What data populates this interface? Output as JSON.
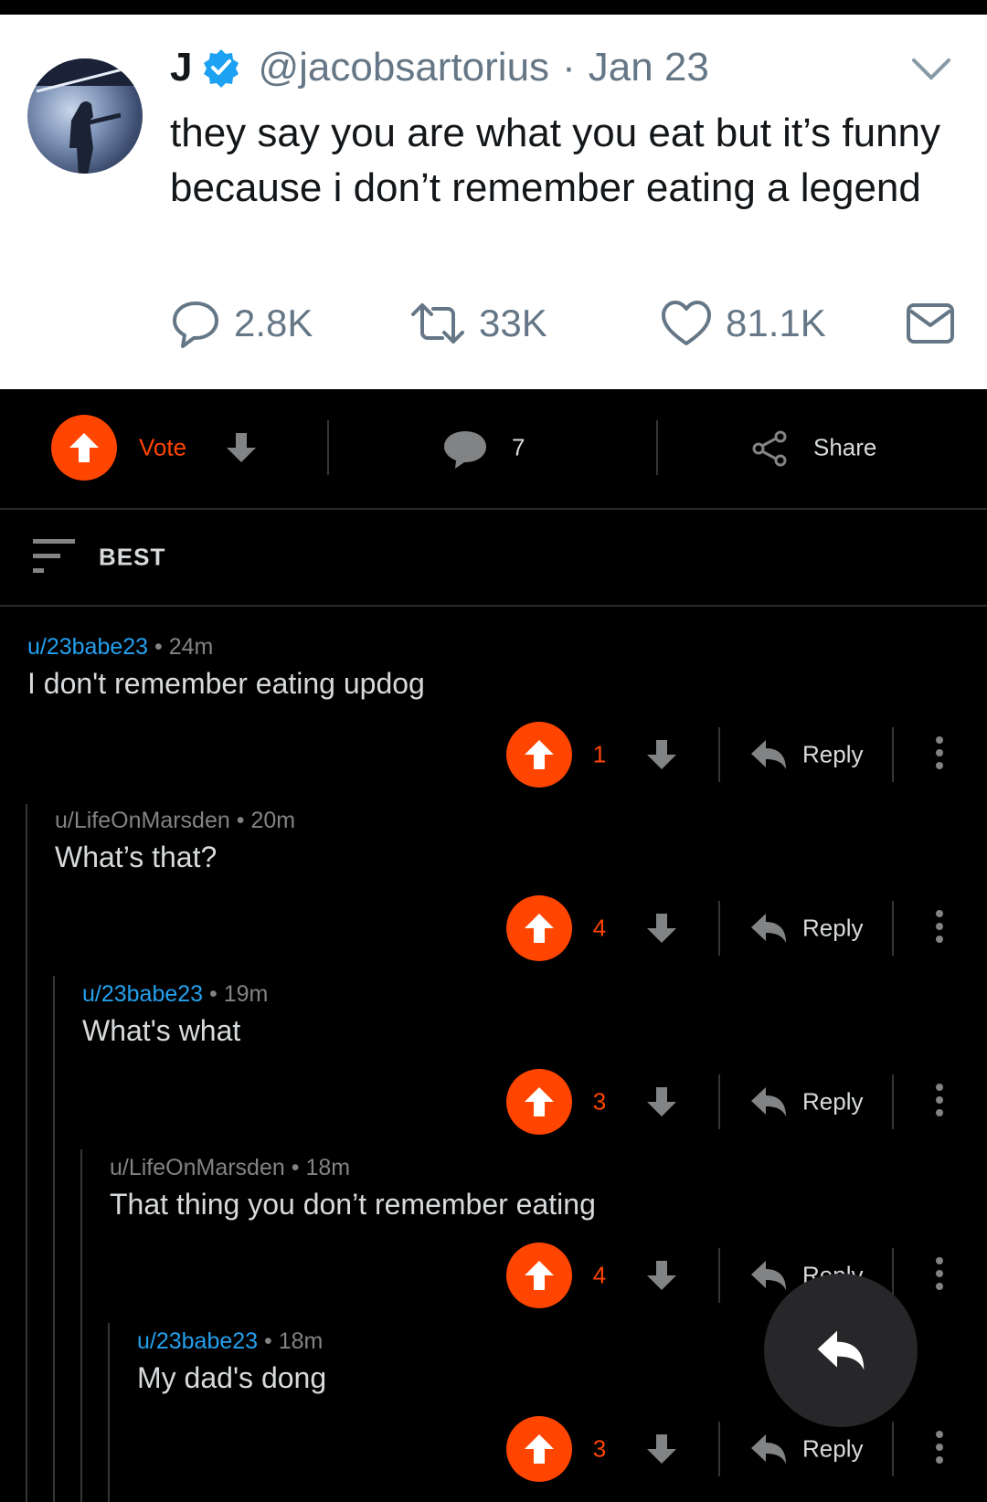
{
  "tweet": {
    "name": "J",
    "handle": "@jacobsartorius",
    "separator": "·",
    "date": "Jan 23",
    "text": "they say you are what you eat but it’s funny because i don’t remember eating a legend",
    "replies": "2.8K",
    "retweets": "33K",
    "likes": "81.1K",
    "icons": [
      "verified-badge-icon",
      "chevron-down-icon",
      "reply-bubble-icon",
      "retweet-icon",
      "heart-icon",
      "envelope-icon"
    ]
  },
  "post_bar": {
    "vote_label": "Vote",
    "comments_count": "7",
    "share_label": "Share"
  },
  "sort": {
    "label": "BEST"
  },
  "comments": [
    {
      "user": "u/23babe23",
      "time": "24m",
      "text": "I don't remember eating updog",
      "score": "1",
      "reply": "Reply"
    },
    {
      "user": "u/LifeOnMarsden",
      "time": "20m",
      "text": "What’s that?",
      "score": "4",
      "reply": "Reply"
    },
    {
      "user": "u/23babe23",
      "time": "19m",
      "text": "What's what",
      "score": "3",
      "reply": "Reply"
    },
    {
      "user": "u/LifeOnMarsden",
      "time": "18m",
      "text": "That thing you don’t remember eating",
      "score": "4",
      "reply": "Reply"
    },
    {
      "user": "u/23babe23",
      "time": "18m",
      "text": "My dad's dong",
      "score": "3",
      "reply": "Reply"
    }
  ],
  "colors": {
    "upvote": "#ff4500",
    "user_blue": "#24a0ed",
    "twitter_blue": "#1da1f2"
  }
}
